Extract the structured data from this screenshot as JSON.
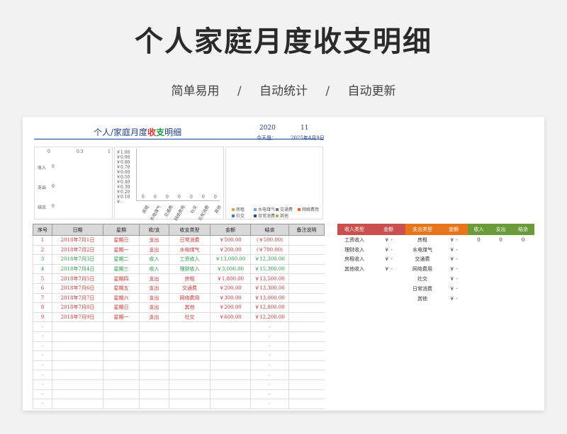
{
  "header": {
    "title": "个人家庭月度收支明细",
    "subtitles": [
      "简单易用",
      "自动统计",
      "自动更新"
    ],
    "separator": "/"
  },
  "sheet": {
    "title_part1": "个人/家庭月度",
    "title_inc": "收",
    "title_exp": "支",
    "title_part2": "明细",
    "year": "2020",
    "month": "11",
    "today_label": "今天是：",
    "today_value": "2025年4月9日"
  },
  "panel1": {
    "axis_ticks": [
      "0",
      "0.5",
      "1"
    ],
    "rows": [
      {
        "label": "收入",
        "value": "0"
      },
      {
        "label": "支出",
        "value": "0"
      },
      {
        "label": "结余",
        "value": "0"
      }
    ]
  },
  "panel2": {
    "y_ticks": [
      "￥1.00",
      "￥0.90",
      "￥0.80",
      "￥0.70",
      "￥0.60",
      "￥0.50",
      "￥0.40",
      "￥0.30",
      "￥0.20",
      "￥0.10",
      "￥-"
    ],
    "categories": [
      "房租",
      "水电煤气",
      "交通费",
      "网络费用",
      "社交",
      "日常消费",
      "其他"
    ],
    "values": [
      "0",
      "0",
      "0",
      "0",
      "0",
      "0",
      "0"
    ]
  },
  "panel3": {
    "legend": [
      {
        "label": "房租",
        "color": "#e8a33d"
      },
      {
        "label": "水电煤气",
        "color": "#6aa6c9"
      },
      {
        "label": "交通费",
        "color": "#7a6a9a"
      },
      {
        "label": "网络费用",
        "color": "#e06030"
      },
      {
        "label": "社交",
        "color": "#4a7ab8"
      },
      {
        "label": "日常消费",
        "color": "#2b4f7a"
      },
      {
        "label": "其他",
        "color": "#b0b040"
      }
    ]
  },
  "ledger": {
    "columns": [
      "序号",
      "日期",
      "星期",
      "收/支",
      "收支类型",
      "金额",
      "结余",
      "备注说明"
    ],
    "rows": [
      {
        "kind": "out",
        "cells": [
          "1",
          "2018年7月1日",
          "星期日",
          "支出",
          "日常消费",
          "￥500.00",
          "(￥500.00)",
          ""
        ]
      },
      {
        "kind": "out",
        "cells": [
          "2",
          "2018年7月2日",
          "星期一",
          "支出",
          "水电煤气",
          "￥200.00",
          "(￥700.00)",
          ""
        ]
      },
      {
        "kind": "in",
        "cells": [
          "3",
          "2018年7月3日",
          "星期二",
          "收入",
          "工资收入",
          "￥13,000.00",
          "￥12,300.00",
          ""
        ]
      },
      {
        "kind": "in",
        "cells": [
          "4",
          "2018年7月4日",
          "星期三",
          "收入",
          "理财收入",
          "￥3,000.00",
          "￥15,300.00",
          ""
        ]
      },
      {
        "kind": "out",
        "cells": [
          "5",
          "2018年7月5日",
          "星期四",
          "支出",
          "房租",
          "￥1,800.00",
          "￥13,500.00",
          ""
        ]
      },
      {
        "kind": "out",
        "cells": [
          "6",
          "2018年7月6日",
          "星期五",
          "支出",
          "交通费",
          "￥200.00",
          "￥13,300.00",
          ""
        ]
      },
      {
        "kind": "out",
        "cells": [
          "7",
          "2018年7月7日",
          "星期六",
          "支出",
          "网络费用",
          "￥300.00",
          "￥13,000.00",
          ""
        ]
      },
      {
        "kind": "out",
        "cells": [
          "8",
          "2018年7月8日",
          "星期日",
          "支出",
          "其他",
          "￥200.00",
          "￥12,800.00",
          ""
        ]
      },
      {
        "kind": "out",
        "cells": [
          "9",
          "2018年7月9日",
          "星期一",
          "支出",
          "社交",
          "￥600.00",
          "￥12,200.00",
          ""
        ]
      },
      {
        "kind": "empty",
        "cells": [
          "-",
          "",
          "",
          "",
          "",
          "",
          "-",
          ""
        ]
      },
      {
        "kind": "empty",
        "cells": [
          "-",
          "",
          "",
          "",
          "",
          "",
          "-",
          ""
        ]
      },
      {
        "kind": "empty",
        "cells": [
          "-",
          "",
          "",
          "",
          "",
          "",
          "-",
          ""
        ]
      },
      {
        "kind": "empty",
        "cells": [
          "-",
          "",
          "",
          "",
          "",
          "",
          "-",
          ""
        ]
      },
      {
        "kind": "empty",
        "cells": [
          "-",
          "",
          "",
          "",
          "",
          "",
          "-",
          ""
        ]
      },
      {
        "kind": "empty",
        "cells": [
          "-",
          "",
          "",
          "",
          "",
          "",
          "-",
          ""
        ]
      },
      {
        "kind": "empty",
        "cells": [
          "-",
          "",
          "",
          "",
          "",
          "",
          "-",
          ""
        ]
      },
      {
        "kind": "empty",
        "cells": [
          "-",
          "",
          "",
          "",
          "",
          "",
          "-",
          ""
        ]
      },
      {
        "kind": "empty",
        "cells": [
          "-",
          "",
          "",
          "",
          "",
          "",
          "-",
          ""
        ]
      }
    ]
  },
  "summary": {
    "headers": [
      {
        "label": "收入类型",
        "color": "#c9504f"
      },
      {
        "label": "金额",
        "color": "#c9504f"
      },
      {
        "label": "支出类型",
        "color": "#e8741c"
      },
      {
        "label": "金额",
        "color": "#e8741c"
      },
      {
        "label": "收入",
        "color": "#6a9a3a"
      },
      {
        "label": "支出",
        "color": "#6a9a3a"
      },
      {
        "label": "结余",
        "color": "#6a9a3a"
      }
    ],
    "rows": [
      [
        "工资收入",
        "￥ -",
        "房租",
        "￥ -",
        "0",
        "0",
        "0"
      ],
      [
        "理财收入",
        "￥ -",
        "水电煤气",
        "￥ -",
        "",
        "",
        ""
      ],
      [
        "房租收入",
        "￥ -",
        "交通费",
        "￥ -",
        "",
        "",
        ""
      ],
      [
        "其他收入",
        "￥ -",
        "网络费用",
        "￥ -",
        "",
        "",
        ""
      ],
      [
        "",
        "",
        "社交",
        "￥ -",
        "",
        "",
        ""
      ],
      [
        "",
        "",
        "日常消费",
        "￥ -",
        "",
        "",
        ""
      ],
      [
        "",
        "",
        "其他",
        "￥ -",
        "",
        "",
        ""
      ]
    ]
  }
}
